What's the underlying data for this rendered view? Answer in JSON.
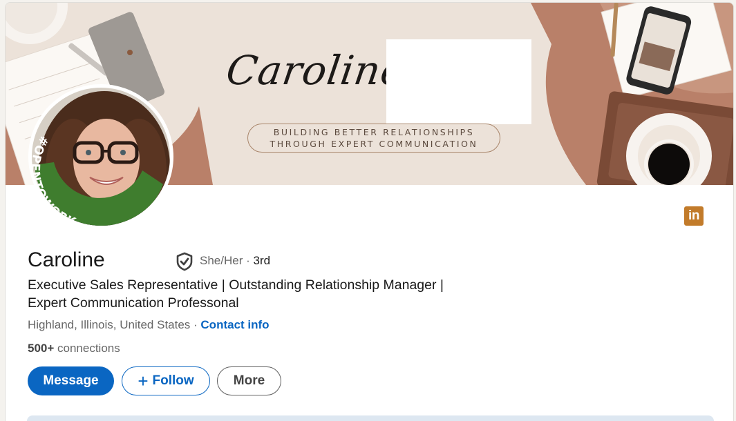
{
  "banner": {
    "script_name": "Caroline",
    "tagline_line1": "BUILDING BETTER RELATIONSHIPS",
    "tagline_line2": "THROUGH EXPERT COMMUNICATION"
  },
  "avatar": {
    "frame_text": "#OPENTOWORK",
    "frame_color": "#3f7d2e"
  },
  "profile": {
    "name": "Caroline",
    "pronouns": "She/Her",
    "separator": " · ",
    "degree": "3rd",
    "headline_line1": "Executive Sales Representative | Outstanding Relationship Manager |",
    "headline_line2": "Expert Communication Professonal",
    "location": "Highland, Illinois, United States",
    "location_separator": " · ",
    "contact_info": "Contact info",
    "connections_count": "500+",
    "connections_label": " connections"
  },
  "actions": {
    "message": "Message",
    "follow_plus": "+",
    "follow": "Follow",
    "more": "More"
  },
  "icons": {
    "linkedin": "linkedin-logo-icon",
    "linkedin_text": "in",
    "verified": "verified-shield-icon"
  },
  "colors": {
    "accent": "#0a66c2",
    "linkedin_badge": "#c27b2a",
    "banner_bg": "#ece2d9",
    "banner_accent": "#b98069"
  }
}
